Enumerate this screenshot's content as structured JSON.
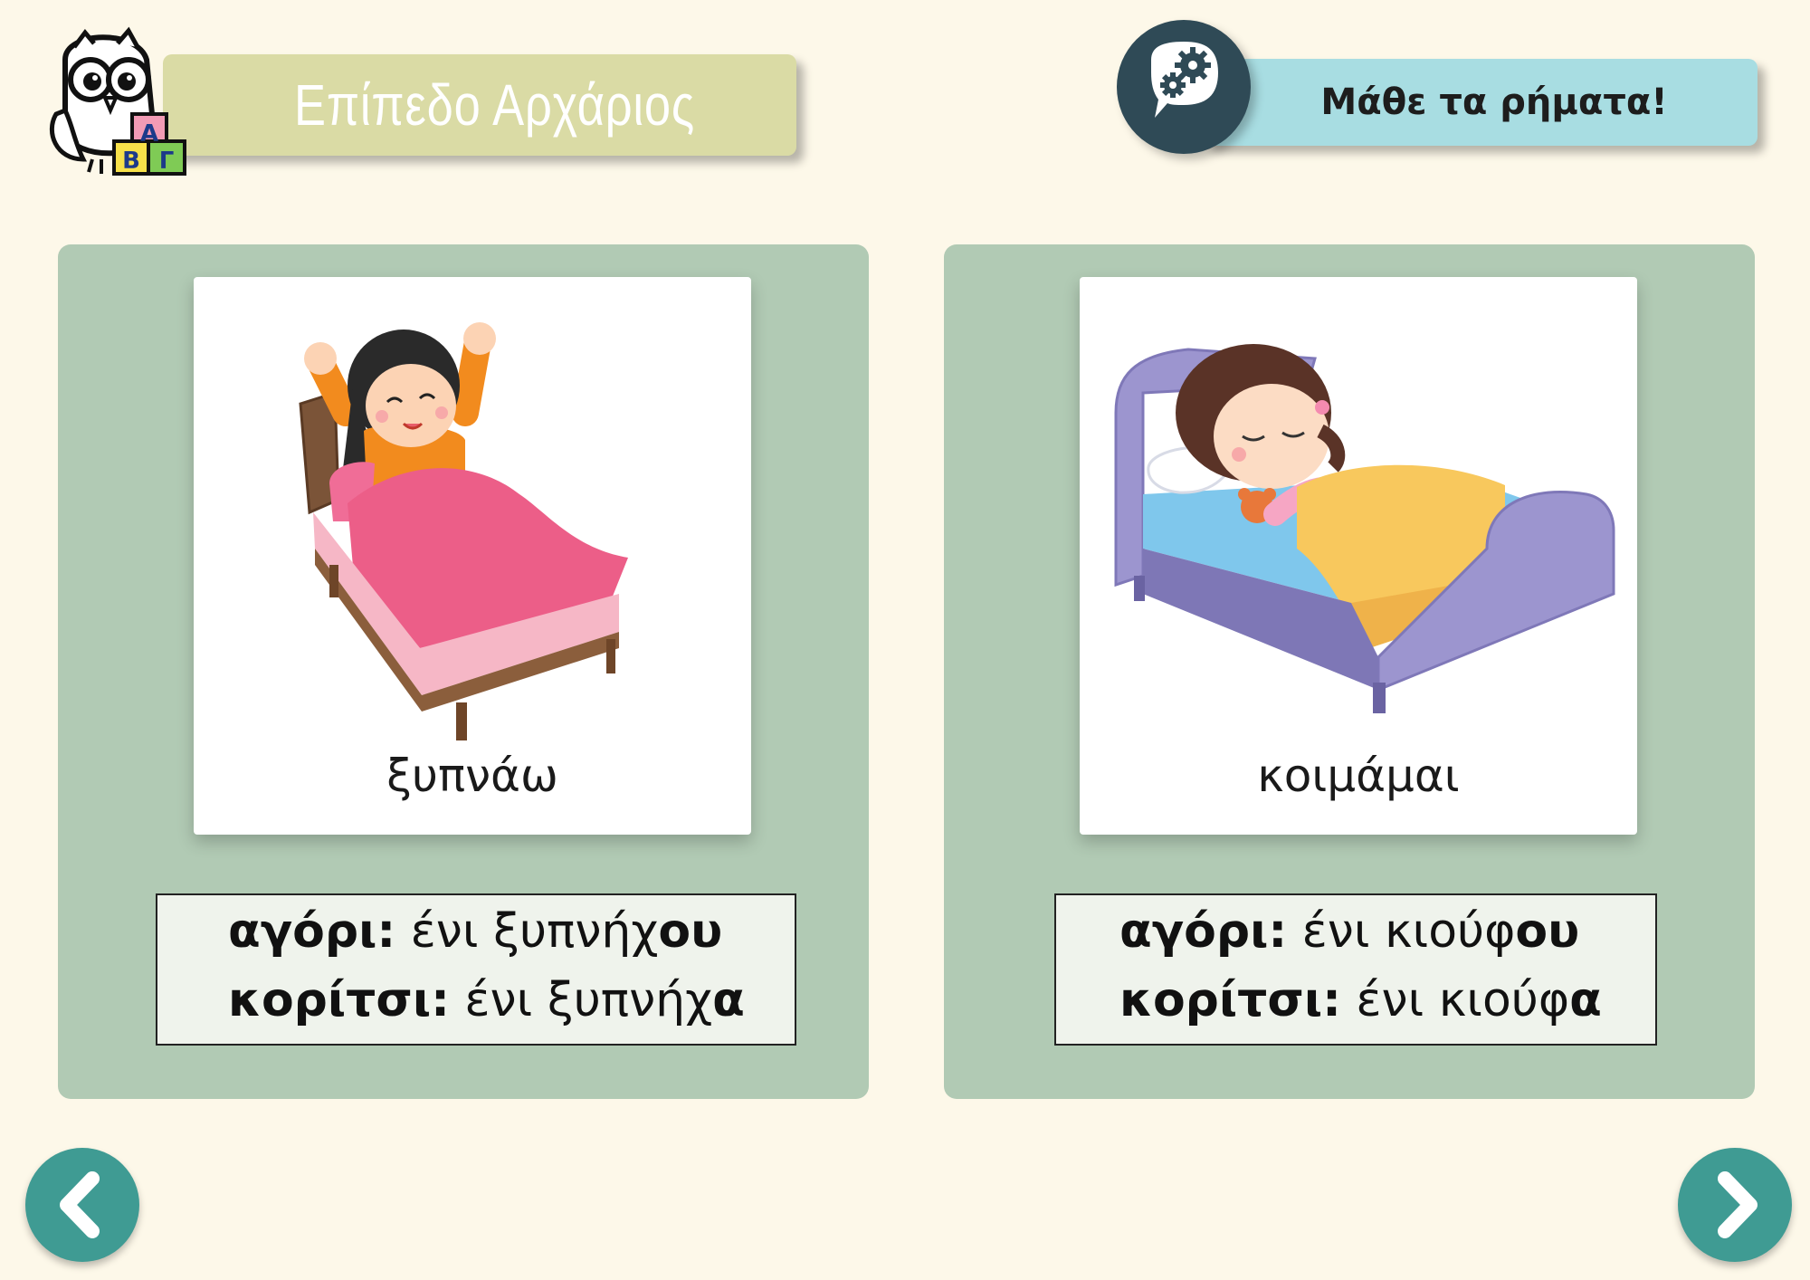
{
  "header": {
    "level_title": "Επίπεδο Αρχάριος",
    "verbs_title": "Μάθε τα ρήματα!",
    "owl_blocks": [
      "Α",
      "Β",
      "Γ"
    ]
  },
  "cards": [
    {
      "word": "ξυπνάω",
      "boy_label": "αγόρι:",
      "boy_stem": " ένι ξυπνήχ",
      "boy_ending": "ου",
      "girl_label": "κορίτσι:",
      "girl_stem": " ένι ξυπνήχ",
      "girl_ending": "α"
    },
    {
      "word": "κοιμάμαι",
      "boy_label": "αγόρι:",
      "boy_stem": " ένι κιούφ",
      "boy_ending": "ου",
      "girl_label": "κορίτσι:",
      "girl_stem": " ένι κιούφ",
      "girl_ending": "α"
    }
  ],
  "colors": {
    "background": "#fdf8e9",
    "level_banner": "#dadba5",
    "verbs_banner": "#a8dde2",
    "panel": "#b1cab4",
    "nav": "#3f9b93"
  },
  "icons": {
    "owl": "owl-mascot-icon",
    "gear": "gears-speech-icon",
    "prev": "chevron-left-icon",
    "next": "chevron-right-icon"
  }
}
